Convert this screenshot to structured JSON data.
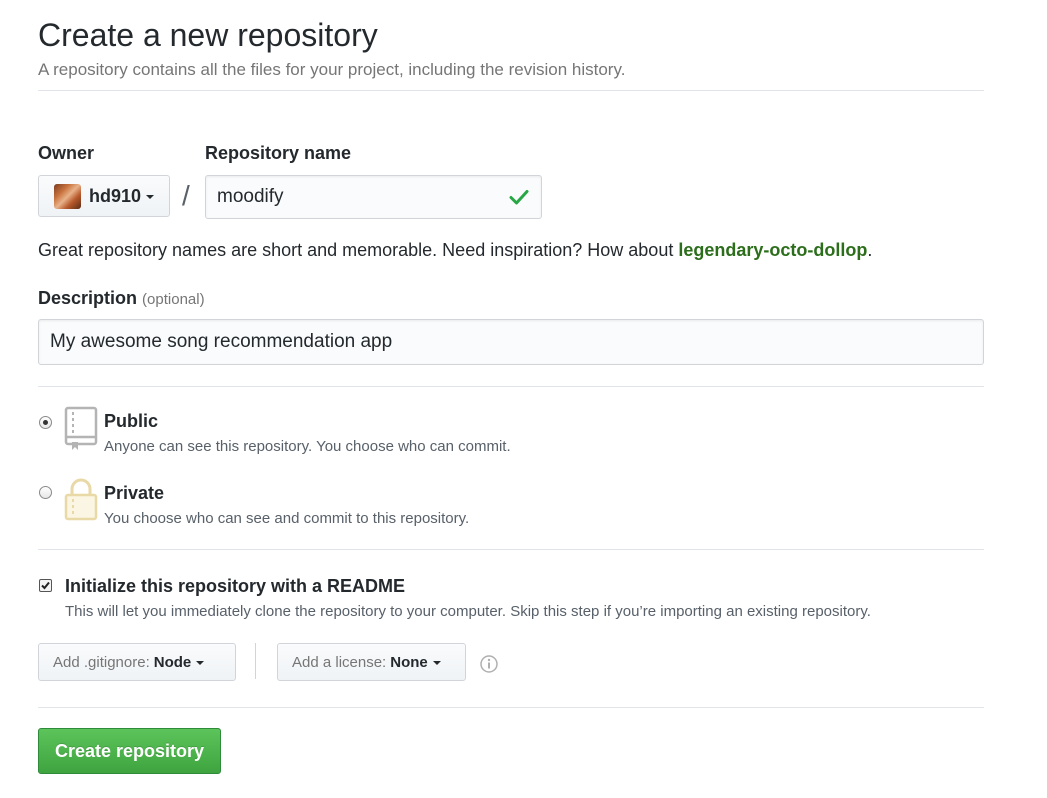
{
  "header": {
    "title": "Create a new repository",
    "subtitle": "A repository contains all the files for your project, including the revision history."
  },
  "owner": {
    "label": "Owner",
    "name": "hd910"
  },
  "repo": {
    "label": "Repository name",
    "value": "moodify",
    "slash": "/"
  },
  "hint": {
    "text": "Great repository names are short and memorable. Need inspiration? How about ",
    "suggestion": "legendary-octo-dollop",
    "end": "."
  },
  "description": {
    "label": "Description",
    "optional": "(optional)",
    "value": "My awesome song recommendation app"
  },
  "visibility": {
    "selected": "public",
    "public": {
      "title": "Public",
      "desc": "Anyone can see this repository. You choose who can commit."
    },
    "private": {
      "title": "Private",
      "desc": "You choose who can see and commit to this repository."
    }
  },
  "readme": {
    "checked": true,
    "title": "Initialize this repository with a README",
    "desc": "This will let you immediately clone the repository to your computer. Skip this step if you’re importing an existing repository."
  },
  "gitignore": {
    "label": "Add .gitignore:",
    "value": "Node"
  },
  "license": {
    "label": "Add a license:",
    "value": "None"
  },
  "submit": {
    "label": "Create repository"
  },
  "colors": {
    "suggestion": "#2c6e1b",
    "primary_button": "#4cb84b",
    "check": "#28a745",
    "lock": "#e8d9a6"
  }
}
